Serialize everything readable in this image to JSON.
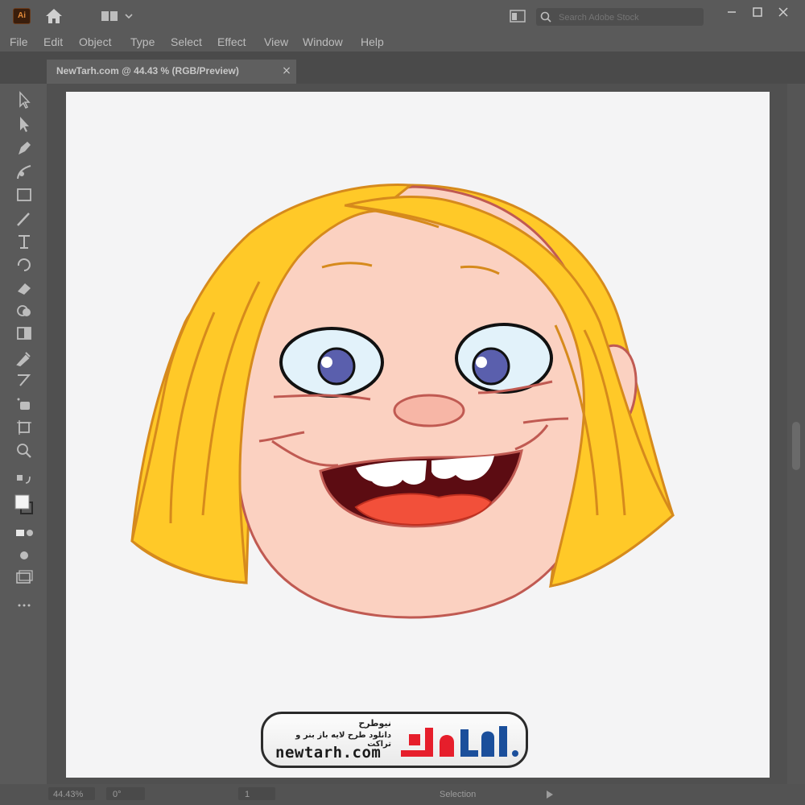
{
  "app": {
    "search_placeholder": "Search Adobe Stock"
  },
  "menu": [
    "File",
    "Edit",
    "Object",
    "Type",
    "Select",
    "Effect",
    "View",
    "Window",
    "Help"
  ],
  "document_tab": {
    "title": "NewTarh.com @ 44.43 % (RGB/Preview)"
  },
  "statusbar": {
    "zoom": "44.43%",
    "rotation": "0°",
    "artboard_number": "1",
    "mode": "Selection"
  },
  "watermark": {
    "name_fa": "نیوطرح",
    "tagline_fa": "دانلود طرح لایه باز بنر و تراکت",
    "url": "newtarh.com",
    "logo_fa": "نیوطرح"
  },
  "colors": {
    "hair": "#ffc928",
    "hair_outline": "#d68a1c",
    "skin": "#fbd1c1",
    "skin_outline": "#c05a52",
    "eye_white": "#e2f2fa",
    "iris": "#5a5fad",
    "mouth": "#5c0c12",
    "tongue": "#f2503a",
    "logo_red": "#e61e2b",
    "logo_blue": "#1b4f9b"
  },
  "icons": [
    "illustrator-logo-icon",
    "home-icon",
    "workspace-icon",
    "arrange-documents-icon",
    "search-icon",
    "minimize-icon",
    "maximize-icon",
    "close-icon"
  ]
}
